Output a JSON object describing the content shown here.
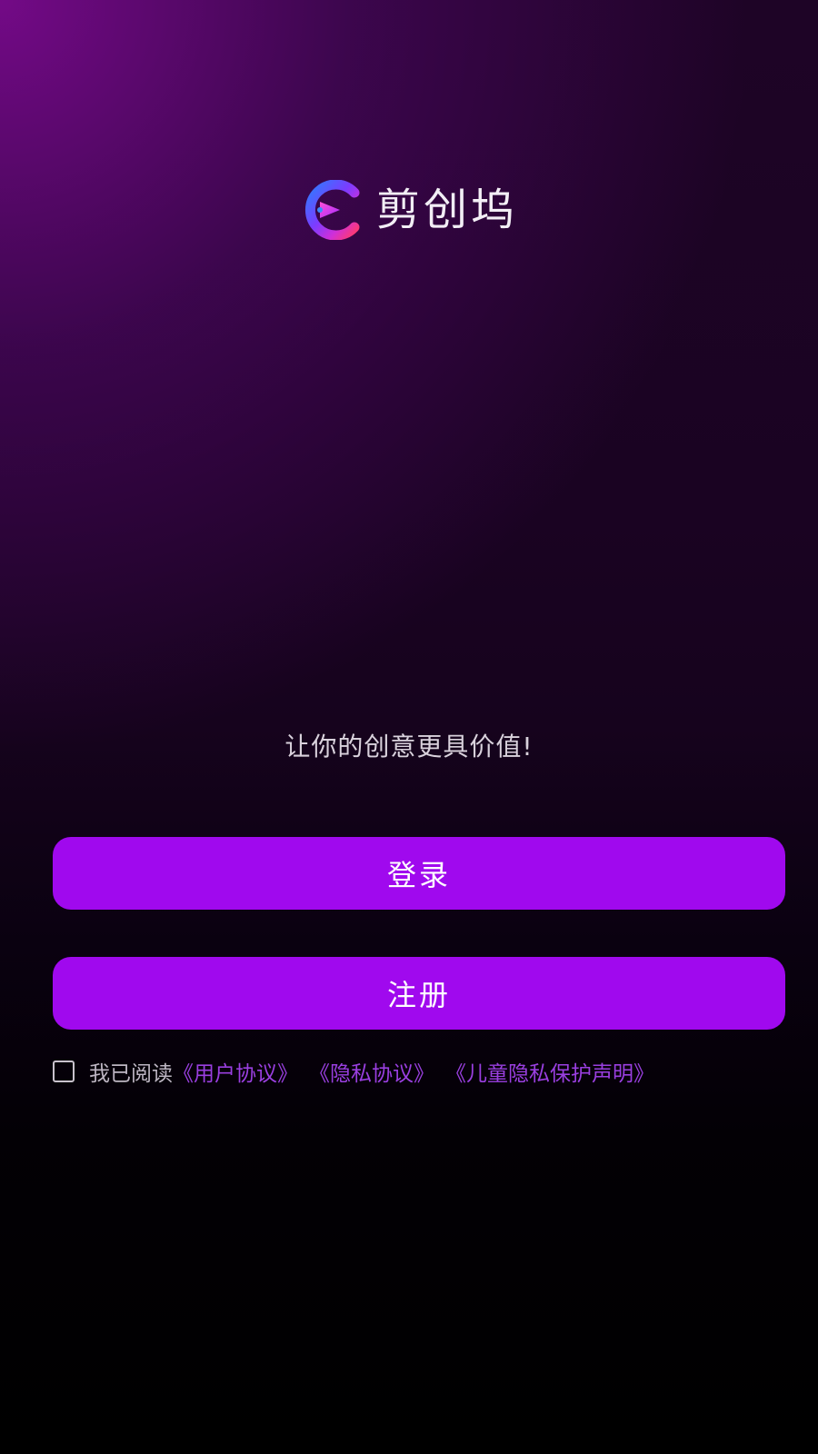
{
  "app": {
    "name": "剪创坞",
    "logo_icon": "play-c-logo-icon"
  },
  "colors": {
    "button_bg": "#a009ee",
    "link": "#9a3fe0",
    "background_top": "#780a8c",
    "background_bottom": "#000000"
  },
  "slogan": "让你的创意更具价值!",
  "buttons": {
    "login_label": "登录",
    "register_label": "注册"
  },
  "agreement": {
    "checked": false,
    "prefix": "我已阅读",
    "links": [
      "《用户协议》",
      "《隐私协议》",
      "《儿童隐私保护声明》"
    ]
  }
}
